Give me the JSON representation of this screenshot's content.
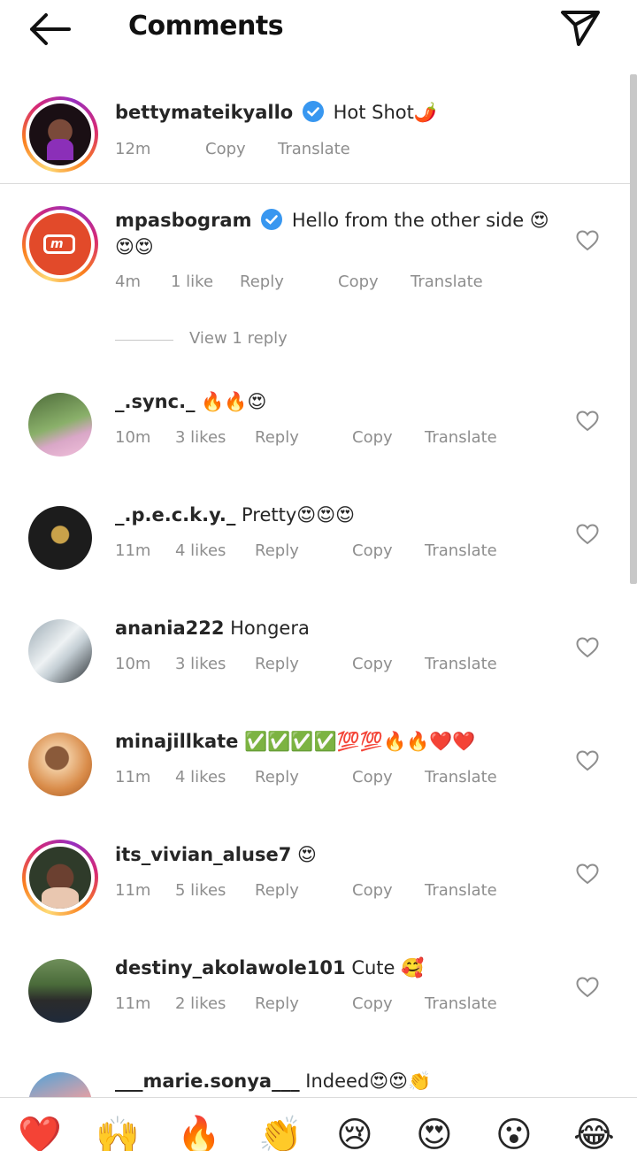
{
  "header": {
    "title": "Comments",
    "back_icon": "arrow-left-icon",
    "share_icon": "paper-plane-icon"
  },
  "caption": {
    "username": "bettymateikyallo",
    "verified": true,
    "text": "Hot Shot🌶️",
    "time": "12m",
    "copy": "Copy",
    "translate": "Translate"
  },
  "comments": [
    {
      "username": "mpasbogram",
      "verified": true,
      "text": "Hello from the other side 😍😍😍",
      "time": "4m",
      "likes": "1 like",
      "reply": "Reply",
      "copy": "Copy",
      "translate": "Translate",
      "view_replies": "View 1 reply"
    },
    {
      "username": "_.sync._",
      "text": "🔥🔥😍",
      "time": "10m",
      "likes": "3 likes",
      "reply": "Reply",
      "copy": "Copy",
      "translate": "Translate"
    },
    {
      "username": "_.p.e.c.k.y._",
      "text": "Pretty😍😍😍",
      "time": "11m",
      "likes": "4 likes",
      "reply": "Reply",
      "copy": "Copy",
      "translate": "Translate"
    },
    {
      "username": "anania222",
      "text": "Hongera",
      "time": "10m",
      "likes": "3 likes",
      "reply": "Reply",
      "copy": "Copy",
      "translate": "Translate"
    },
    {
      "username": "minajillkate",
      "text": "✅✅✅✅💯💯🔥🔥❤️❤️",
      "time": "11m",
      "likes": "4 likes",
      "reply": "Reply",
      "copy": "Copy",
      "translate": "Translate"
    },
    {
      "username": "its_vivian_aluse7",
      "text": "😍",
      "time": "11m",
      "likes": "5 likes",
      "reply": "Reply",
      "copy": "Copy",
      "translate": "Translate"
    },
    {
      "username": "destiny_akolawole101",
      "text": "Cute 🥰",
      "time": "11m",
      "likes": "2 likes",
      "reply": "Reply",
      "copy": "Copy",
      "translate": "Translate"
    },
    {
      "username": "___marie.sonya___",
      "text": "Indeed😍😍👏"
    }
  ],
  "emoji_bar": [
    "❤️",
    "🙌",
    "🔥",
    "👏",
    "😢",
    "😍",
    "😮",
    "😂"
  ],
  "colors": {
    "verified_blue": "#3897f0",
    "meta_grey": "#8e8e8e",
    "divider": "#dbdbdb"
  }
}
